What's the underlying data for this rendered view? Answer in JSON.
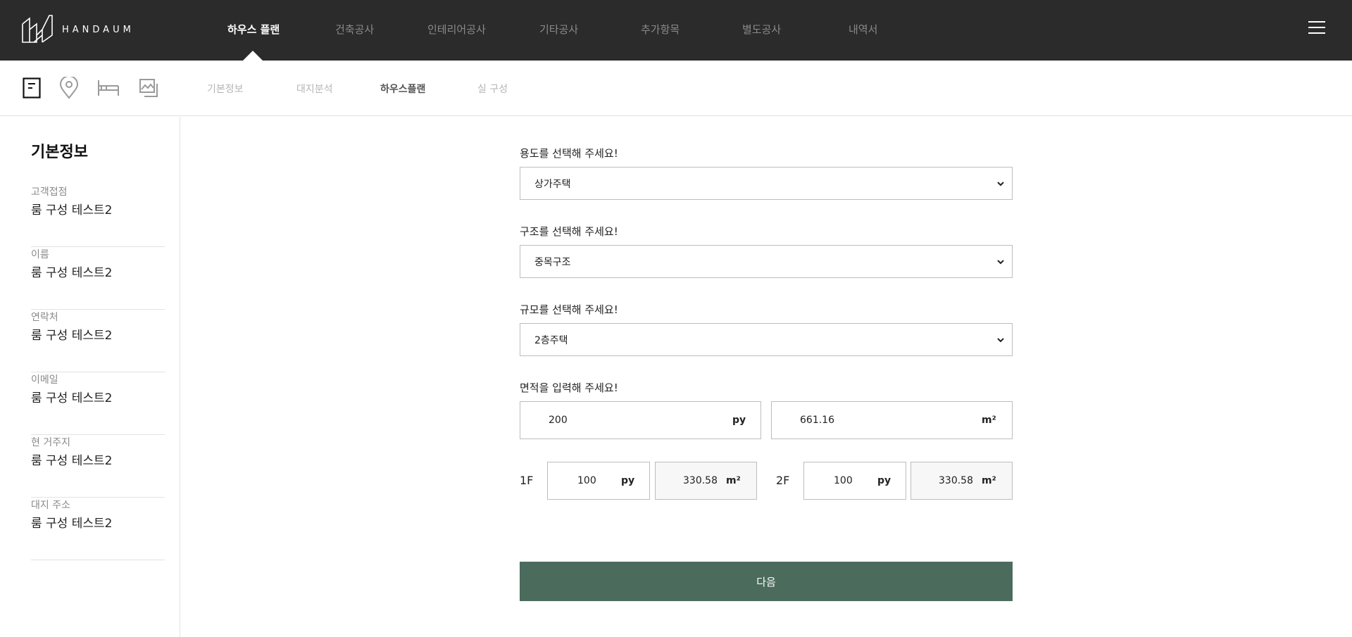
{
  "brand": {
    "name": "HANDAUM"
  },
  "topnav": {
    "items": [
      {
        "label": "하우스 플랜",
        "active": true
      },
      {
        "label": "건축공사"
      },
      {
        "label": "인테리어공사"
      },
      {
        "label": "기타공사"
      },
      {
        "label": "추가항목"
      },
      {
        "label": "별도공사"
      },
      {
        "label": "내역서"
      }
    ],
    "menu_icon": "hamburger-menu-icon"
  },
  "subnav": {
    "icons": [
      "document-icon",
      "location-pin-icon",
      "bed-icon",
      "image-gallery-icon"
    ],
    "tabs": [
      {
        "label": "기본정보"
      },
      {
        "label": "대지분석"
      },
      {
        "label": "하우스플랜",
        "active": true
      },
      {
        "label": "실 구성"
      }
    ]
  },
  "sidebar": {
    "title": "기본정보",
    "items": [
      {
        "label": "고객접점",
        "value": "룸 구성 테스트2"
      },
      {
        "label": "이름",
        "value": "룸 구성 테스트2"
      },
      {
        "label": "연락처",
        "value": "룸 구성 테스트2"
      },
      {
        "label": "이메일",
        "value": "룸 구성 테스트2"
      },
      {
        "label": "현 거주지",
        "value": "룸 구성 테스트2"
      },
      {
        "label": "대지 주소",
        "value": "룸 구성 테스트2"
      }
    ]
  },
  "form": {
    "usage": {
      "label": "용도를 선택해 주세요!",
      "selected": "상가주택"
    },
    "structure": {
      "label": "구조를 선택해 주세요!",
      "selected": "중목구조"
    },
    "scale": {
      "label": "규모를 선택해 주세요!",
      "selected": "2층주택"
    },
    "area": {
      "label": "면적을 입력해 주세요!",
      "py_value": "200",
      "py_unit": "py",
      "m2_value": "661.16",
      "m2_unit": "m²"
    },
    "floors": [
      {
        "label": "1F",
        "py_value": "100",
        "py_unit": "py",
        "m2_value": "330.58",
        "m2_unit": "m²"
      },
      {
        "label": "2F",
        "py_value": "100",
        "py_unit": "py",
        "m2_value": "330.58",
        "m2_unit": "m²"
      }
    ],
    "next_label": "다음"
  },
  "colors": {
    "topbar": "#2b2b2b",
    "accent_button": "#4b6b5d"
  }
}
